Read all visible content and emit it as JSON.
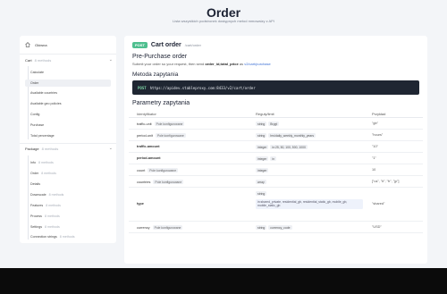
{
  "header": {
    "title": "Order",
    "subtitle": "Lista wszystkich podstronek dostępnych metod mmowaizy z API"
  },
  "sidebar": {
    "home_label": "Główna",
    "cart_group": {
      "label": "Cart",
      "hint": "8 methods"
    },
    "cart_items": [
      {
        "label": "Calculate",
        "hint": ""
      },
      {
        "label": "Order",
        "hint": ""
      },
      {
        "label": "Available countries",
        "hint": ""
      },
      {
        "label": "Available geo policies",
        "hint": ""
      },
      {
        "label": "Config",
        "hint": ""
      },
      {
        "label": "Purchase",
        "hint": ""
      },
      {
        "label": "Total percentage",
        "hint": ""
      }
    ],
    "package_group": {
      "label": "Package",
      "hint": "8 methods"
    },
    "package_items": [
      {
        "label": "Info",
        "hint": "8 methods"
      },
      {
        "label": "Order",
        "hint": "8 methods"
      },
      {
        "label": "Details",
        "hint": ""
      },
      {
        "label": "Downscale",
        "hint": "8 methods"
      },
      {
        "label": "Features",
        "hint": "8 methods"
      },
      {
        "label": "Process",
        "hint": "8 methods"
      },
      {
        "label": "Settings",
        "hint": "8 methods"
      },
      {
        "label": "Connection strings",
        "hint": "8 methods"
      }
    ]
  },
  "endpoint": {
    "method": "POST",
    "title": "Cart order",
    "path": "/cart/order"
  },
  "pre_purchase": {
    "heading": "Pre-Purchase order",
    "desc_prefix": "Submit your order so your request, then send ",
    "desc_bold": "order_id,total_price",
    "desc_mid": " as ",
    "desc_link": "v2/cart/purchase"
  },
  "method_section": {
    "heading": "Metoda zapytania",
    "http_method": "POST",
    "url": "https://apidev.stableproxy.com:8433/v2/cart/order"
  },
  "params": {
    "heading": "Parametry zapytania",
    "columns": [
      "Identyfikator",
      "Reguły/limit",
      "Przykład"
    ],
    "rows": [
      {
        "name": "traffic-unit",
        "tag": "Pole konfigurowane",
        "bold": false,
        "rules": [
          "string",
          "Brygt"
        ],
        "example": "\"gb\""
      },
      {
        "name": "period-unit",
        "tag": "Pole konfigurowane",
        "bold": false,
        "rules": [
          "string",
          "hrs/daily_weekly_monthly_years"
        ],
        "example": "\"hours\""
      },
      {
        "name": "traffic-amount",
        "tag": "",
        "bold": true,
        "rules": [
          "integer",
          "in:25, 50, 100, 500, 1000"
        ],
        "example": "\"10\""
      },
      {
        "name": "period-amount",
        "tag": "",
        "bold": true,
        "rules": [
          "integer",
          "in"
        ],
        "example": "\"1\""
      },
      {
        "name": "count",
        "tag": "Pole konfigurowane",
        "bold": false,
        "rules": [
          "integer"
        ],
        "example": "10"
      },
      {
        "name": "countries",
        "tag": "Pole konfigurowane",
        "bold": false,
        "rules": [
          "array"
        ],
        "example": "[\"us\", \"it\", \"fr\", \"jp\"]"
      },
      {
        "name": "type",
        "tag": "",
        "bold": true,
        "rules": [
          "string"
        ],
        "enum": "in:shared_private, residential_gb, residential_static_gb, mobile_gb, mobile_static_gb",
        "example": "\"shared\""
      },
      {
        "name": "currency",
        "tag": "Pole konfigurowane",
        "bold": false,
        "rules": [
          "string",
          "currency_code"
        ],
        "example": "\"USD\""
      }
    ]
  }
}
